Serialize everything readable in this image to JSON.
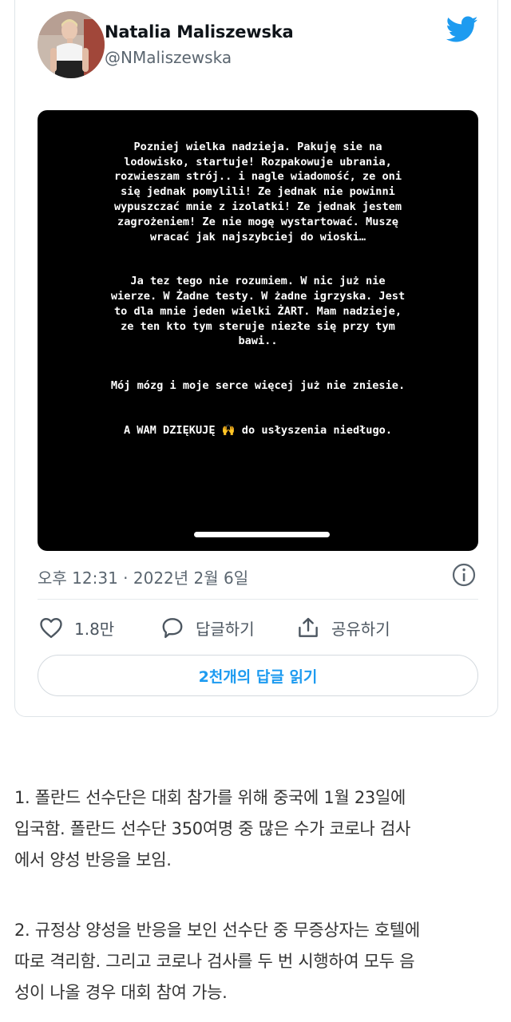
{
  "tweet": {
    "author_name": "Natalia Maliszewska",
    "author_handle": "@NMaliszewska",
    "story_paragraphs": [
      "Pozniej wielka nadzieja. Pakuję sie na\nlodowisko, startuje! Rozpakowuje ubrania,\nrozwieszam strój..  i nagle wiadomość, ze oni\nsię jednak pomylili! Ze jednak nie powinni\nwypuszczać mnie z izolatki! Ze jednak jestem\nzagrożeniem! Ze nie mogę wystartować. Muszę\nwracać jak najszybciej do wioski…",
      "Ja tez tego nie rozumiem. W nic już nie\nwierze. W Żadne testy. W żadne igrzyska. Jest\nto dla mnie jeden wielki ŻART. Mam nadzieje,\nze ten kto tym steruje niezłe się przy tym\nbawi..",
      "Mój mózg i moje serce więcej już nie zniesie.",
      "A WAM DZIĘKUJĘ 🙌 do usłyszenia niedługo."
    ],
    "timestamp": "오후 12:31 · 2022년 2월 6일",
    "actions": {
      "like_count": "1.8만",
      "reply_label": "답글하기",
      "share_label": "공유하기"
    },
    "read_replies_label": "2천개의 답글 읽기",
    "accent_color": "#1d9bf0"
  },
  "article": {
    "paragraph_1_lines": [
      "1. 폴란드 선수단은 대회 참가를 위해 중국에 1월 23일에",
      "입국함. 폴란드 선수단 350여명 중 많은 수가 코로나 검사",
      "에서 양성 반응을 보임."
    ],
    "paragraph_2_lines": [
      "2. 규정상 양성을 반응을 보인 선수단 중 무증상자는 호텔에",
      "따로 격리함. 그리고 코로나 검사를 두 번 시행하여 모두 음",
      "성이 나올 경우 대회 참여 가능."
    ]
  }
}
